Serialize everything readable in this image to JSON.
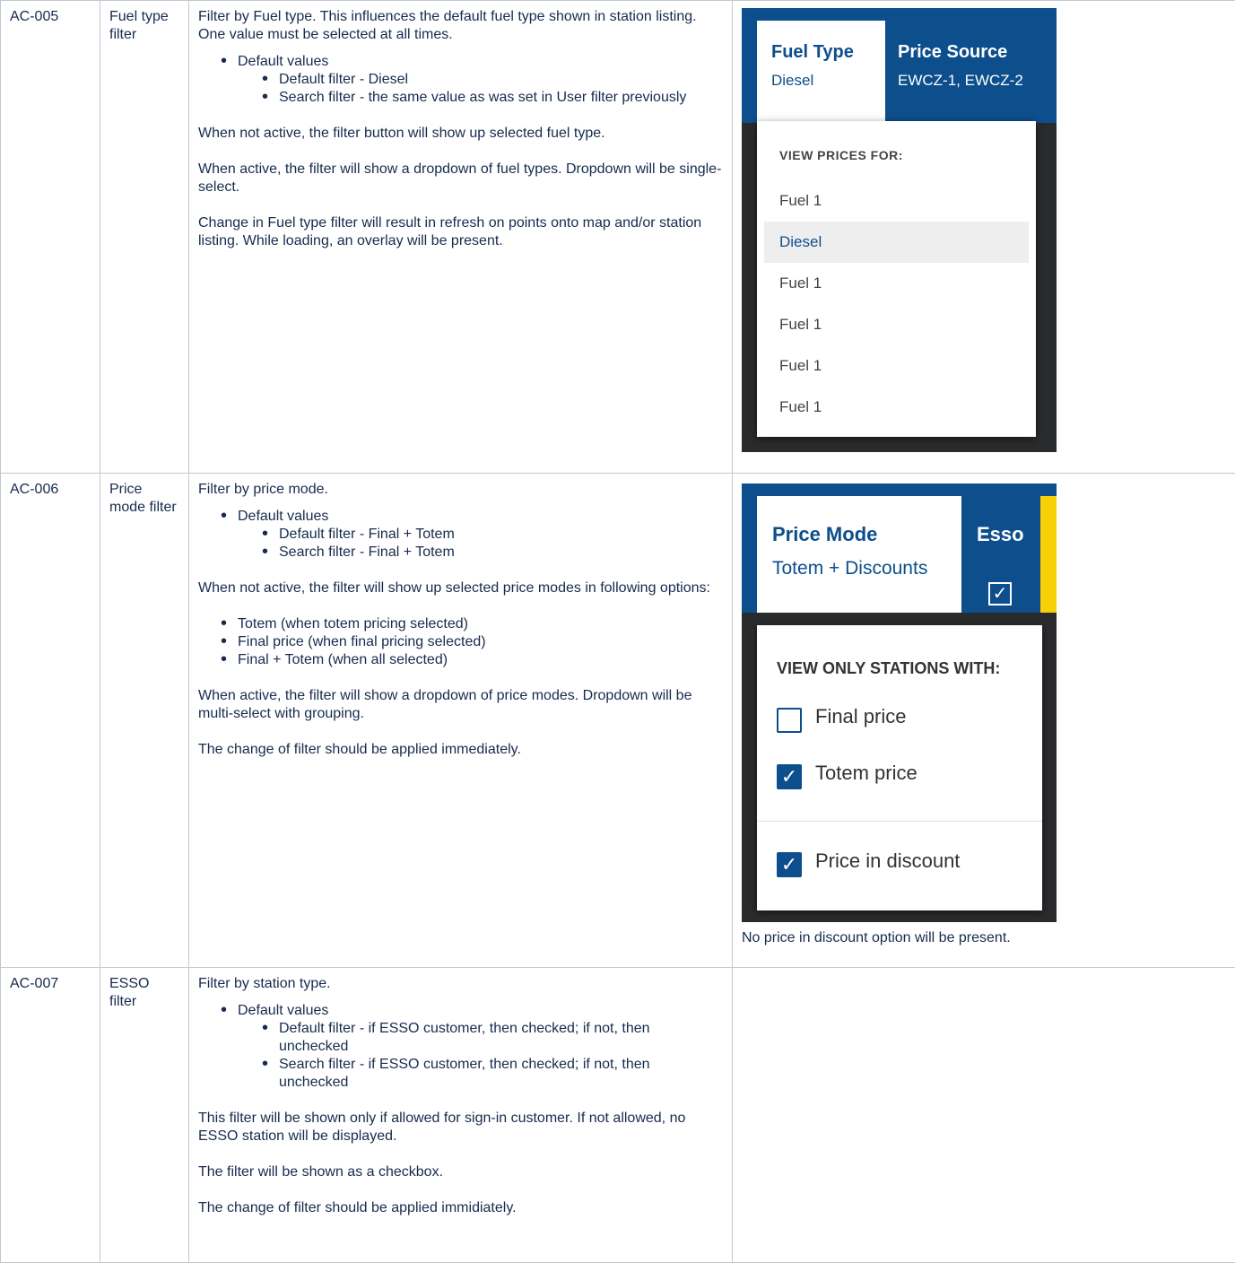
{
  "rows": [
    {
      "id": "AC-005",
      "name": "Fuel type filter",
      "desc": {
        "intro": "Filter by Fuel type. This influences the default fuel type shown in station listing. One value must be selected at all times.",
        "default_values": "Default values",
        "sub": [
          "Default filter - Diesel",
          "Search filter - the same value as was set in User filter previously"
        ],
        "p1": "When not active, the filter button will show up selected fuel type.",
        "p2": "When active, the filter will show a dropdown of fuel types. Dropdown will be single-select.",
        "p3": "Change in Fuel type filter will result in refresh on points onto map and/or station listing. While loading, an overlay will be present."
      },
      "mockup": {
        "active_tab_title": "Fuel Type",
        "active_tab_value": "Diesel",
        "second_tab_title": "Price Source",
        "second_tab_value": "EWCZ-1, EWCZ-2",
        "dropdown_header": "VIEW PRICES FOR:",
        "options": [
          "Fuel 1",
          "Diesel",
          "Fuel 1",
          "Fuel 1",
          "Fuel 1",
          "Fuel 1"
        ],
        "selected_option": "Diesel"
      }
    },
    {
      "id": "AC-006",
      "name": "Price mode filter",
      "desc": {
        "intro": "Filter by price mode.",
        "default_values": "Default values",
        "sub": [
          "Default filter - Final + Totem",
          "Search filter - Final + Totem"
        ],
        "p1": "When not active, the filter will show up selected price modes in following options:",
        "bullets": [
          "Totem (when totem pricing selected)",
          "Final price (when final pricing selected)",
          "Final + Totem (when all selected)"
        ],
        "p2": "When active, the filter will show a dropdown of price modes. Dropdown will be multi-select with grouping.",
        "p3": "The change of filter should be applied immediately."
      },
      "mockup": {
        "active_tab_title": "Price Mode",
        "active_tab_value": "Totem + Discounts",
        "esso_label": "Esso",
        "esso_check": "✓",
        "dropdown_header": "VIEW ONLY STATIONS WITH:",
        "options": [
          {
            "label": "Final price",
            "checked": false
          },
          {
            "label": "Totem price",
            "checked": true
          },
          {
            "label": "Price in discount",
            "checked": true
          }
        ],
        "check_glyph": "✓"
      },
      "caption": "No price in discount option will be present."
    },
    {
      "id": "AC-007",
      "name": "ESSO filter",
      "desc": {
        "intro": "Filter by station type.",
        "default_values": "Default values",
        "sub": [
          "Default filter - if ESSO customer, then checked; if not, then unchecked",
          "Search filter - if ESSO customer, then checked; if not, then unchecked"
        ],
        "p1": "This filter will be shown only if allowed for sign-in customer. If not allowed, no ESSO station will be displayed.",
        "p2": "The filter will be shown as a checkbox.",
        "p3": "The change of filter should be applied immidiately."
      }
    }
  ],
  "colors": {
    "brand_blue": "#0d4e8c",
    "esso_yellow": "#f5d106",
    "map_dark": "#2a2b2d"
  }
}
